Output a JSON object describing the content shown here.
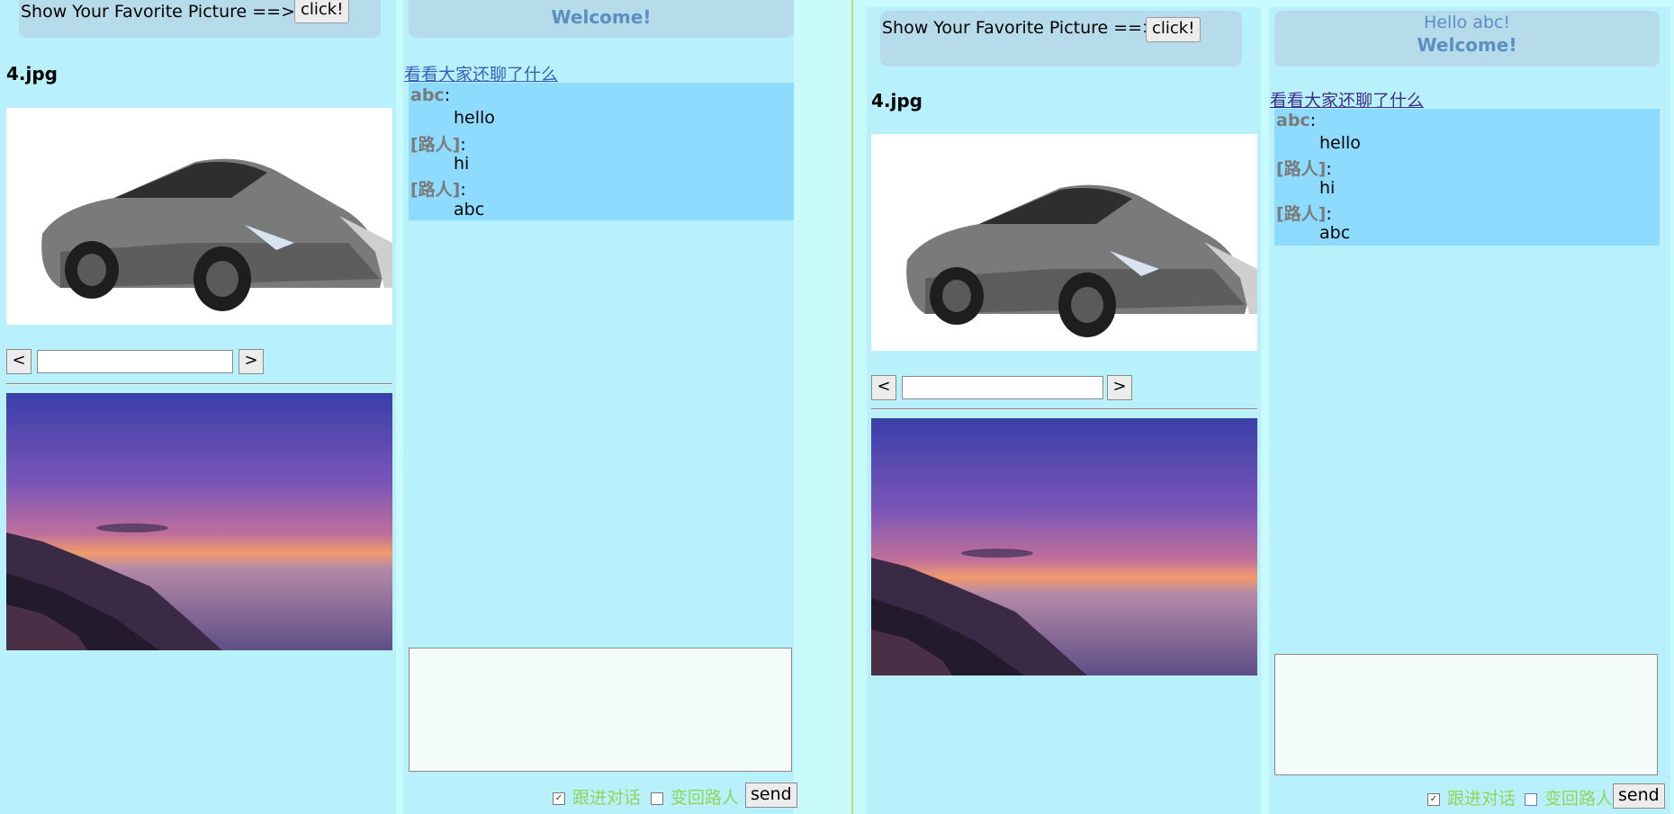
{
  "left_window": {
    "header_text": "Show Your Favorite Picture ==>",
    "click_button": "click!",
    "file_name": "4.jpg",
    "prev_button": "<",
    "next_button": ">",
    "greeting_welcome": "Welcome!",
    "chat_link": "看看大家还聊了什么",
    "messages": [
      {
        "name": "abc",
        "text": "hello"
      },
      {
        "name": "[路人]",
        "text": "hi"
      },
      {
        "name": "[路人]",
        "text": "abc"
      }
    ],
    "opt_follow": "跟进对话",
    "opt_follow_checked": true,
    "opt_anon": "变回路人",
    "opt_anon_checked": false,
    "send_button": "send"
  },
  "right_window": {
    "header_text": "Show Your Favorite Picture ==>",
    "click_button": "click!",
    "file_name": "4.jpg",
    "prev_button": "<",
    "next_button": ">",
    "greeting_hello": "Hello abc!",
    "greeting_welcome": "Welcome!",
    "chat_link": "看看大家还聊了什么",
    "messages": [
      {
        "name": "abc",
        "text": "hello"
      },
      {
        "name": "[路人]",
        "text": "hi"
      },
      {
        "name": "[路人]",
        "text": "abc"
      }
    ],
    "opt_follow": "跟进对话",
    "opt_follow_checked": true,
    "opt_anon": "变回路人",
    "opt_anon_checked": false,
    "send_button": "send"
  },
  "icons": {
    "checkbox_checked": "checkbox-checked-icon",
    "checkbox_unchecked": "checkbox-unchecked-icon"
  },
  "colors": {
    "page_bg": "#c8fafc",
    "panel_bg": "#b8f0fb",
    "header_bg": "#b6dbea",
    "chat_bg": "#8ddcff",
    "option_text": "#8fd65a",
    "greeting_text": "#5b8fc2"
  }
}
